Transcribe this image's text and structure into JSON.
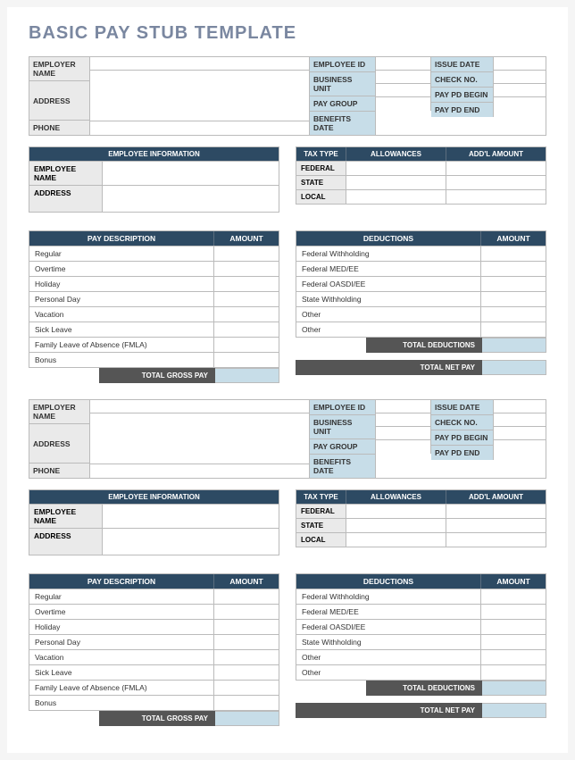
{
  "title": "BASIC PAY STUB TEMPLATE",
  "hdr": {
    "employer_name": "EMPLOYER NAME",
    "address": "ADDRESS",
    "phone": "PHONE",
    "employee_id": "EMPLOYEE ID",
    "business_unit": "BUSINESS UNIT",
    "pay_group": "PAY GROUP",
    "benefits_date": "BENEFITS DATE",
    "issue_date": "ISSUE DATE",
    "check_no": "CHECK NO.",
    "pay_pd_begin": "PAY PD BEGIN",
    "pay_pd_end": "PAY PD END"
  },
  "empinfo": {
    "header": "EMPLOYEE INFORMATION",
    "employee_name": "EMPLOYEE NAME",
    "address": "ADDRESS"
  },
  "tax": {
    "h_type": "TAX TYPE",
    "h_allow": "ALLOWANCES",
    "h_addl": "ADD'L AMOUNT",
    "rows": [
      "FEDERAL",
      "STATE",
      "LOCAL"
    ]
  },
  "pay": {
    "h_desc": "PAY DESCRIPTION",
    "h_amt": "AMOUNT",
    "rows": [
      "Regular",
      "Overtime",
      "Holiday",
      "Personal Day",
      "Vacation",
      "Sick Leave",
      "Family Leave of Absence (FMLA)",
      "Bonus"
    ],
    "total": "TOTAL GROSS PAY"
  },
  "ded": {
    "h_desc": "DEDUCTIONS",
    "h_amt": "AMOUNT",
    "rows": [
      "Federal Withholding",
      "Federal MED/EE",
      "Federal OASDI/EE",
      "State Withholding",
      "Other",
      "Other"
    ],
    "total": "TOTAL DEDUCTIONS"
  },
  "net": "TOTAL NET PAY"
}
